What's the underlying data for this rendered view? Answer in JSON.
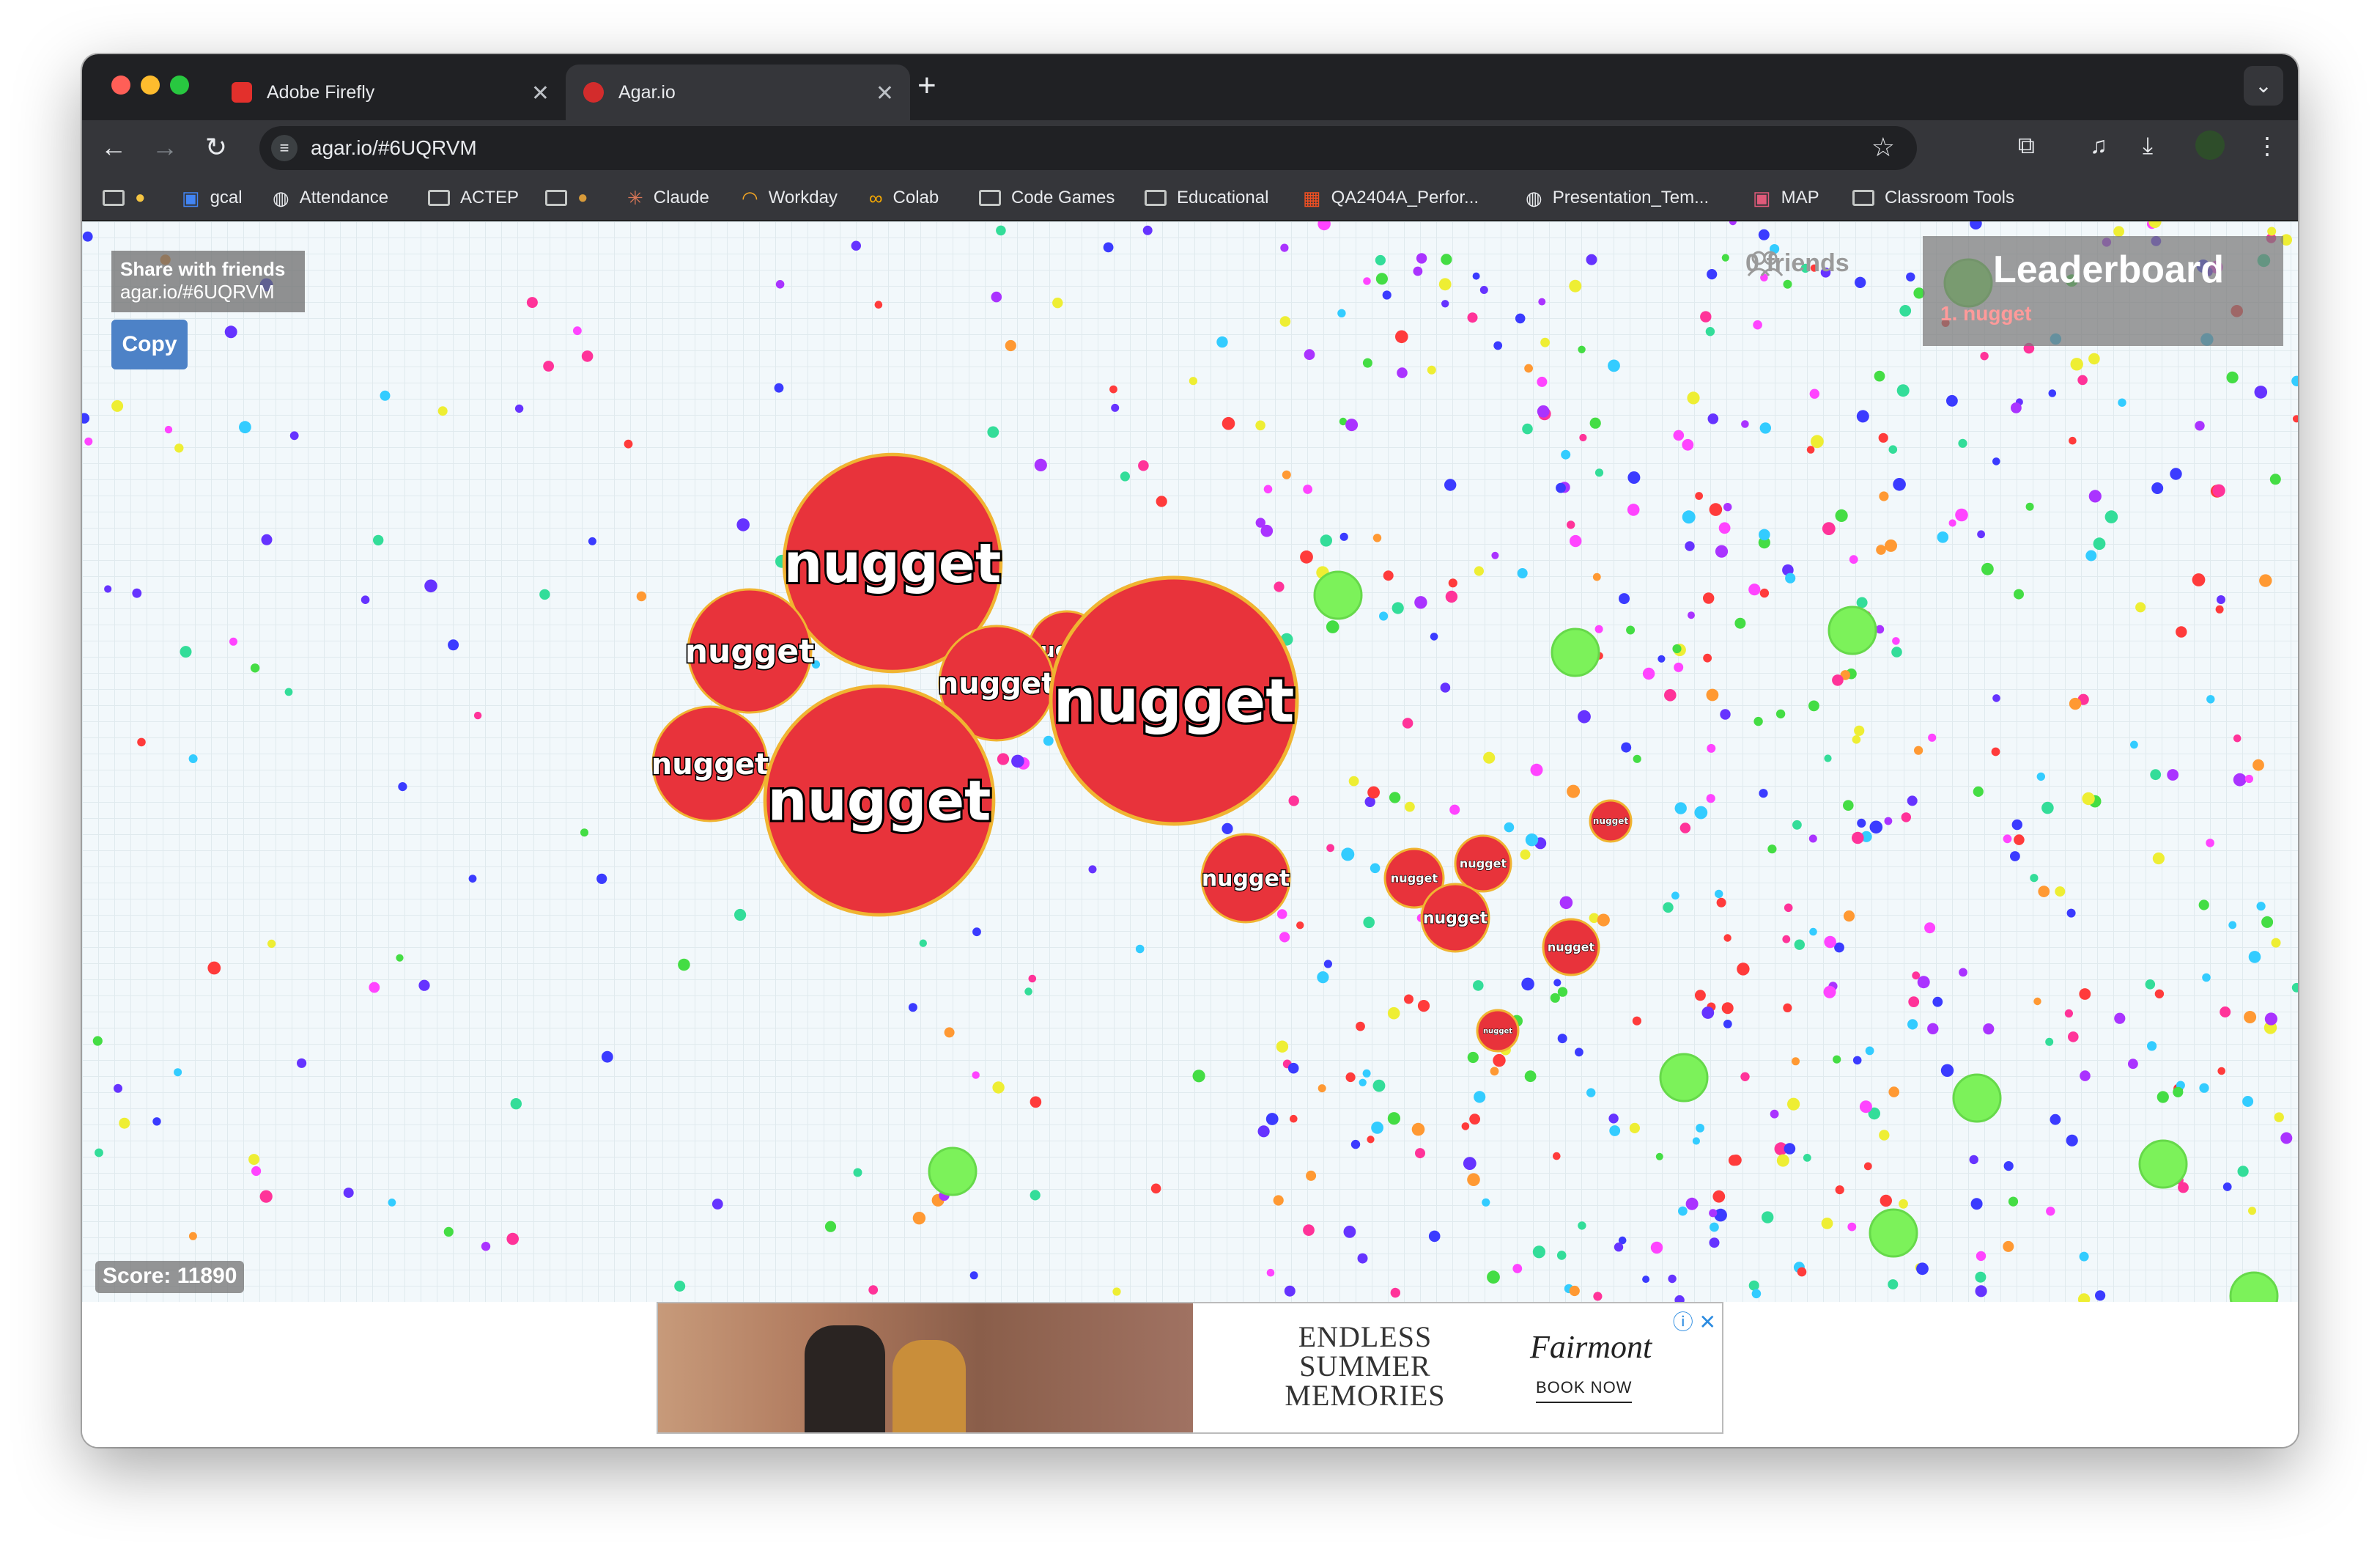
{
  "browser": {
    "tabs": [
      {
        "title": "Adobe Firefly",
        "favicon_color": "#e3302c"
      },
      {
        "title": "Agar.io",
        "favicon_color": "#d32c2c"
      }
    ],
    "new_tab_label": "+",
    "url": "agar.io/#6UQRVM",
    "bookmarks": [
      {
        "label": "",
        "icon": "folder-emoji-icon"
      },
      {
        "label": "gcal",
        "icon": "calendar-icon"
      },
      {
        "label": "Attendance",
        "icon": "globe-icon"
      },
      {
        "label": "ACTEP",
        "icon": "folder-icon"
      },
      {
        "label": "",
        "icon": "folder-emoji-icon"
      },
      {
        "label": "Claude",
        "icon": "claude-icon"
      },
      {
        "label": "Workday",
        "icon": "workday-icon"
      },
      {
        "label": "Colab",
        "icon": "colab-icon"
      },
      {
        "label": "Code Games",
        "icon": "folder-icon"
      },
      {
        "label": "Educational",
        "icon": "folder-icon"
      },
      {
        "label": "QA2404A_Perfor...",
        "icon": "microsoft-icon"
      },
      {
        "label": "Presentation_Tem...",
        "icon": "globe-icon"
      },
      {
        "label": "MAP",
        "icon": "map-icon"
      },
      {
        "label": "Classroom Tools",
        "icon": "folder-icon"
      }
    ]
  },
  "game": {
    "share": {
      "title": "Share with friends",
      "link": "agar.io/#6UQRVM"
    },
    "copy_label": "Copy",
    "friends_label": "0 friends",
    "leaderboard": {
      "title": "Leaderboard",
      "entries": [
        "1. nugget"
      ]
    },
    "score_label": "Score: 11890",
    "player_name": "nugget",
    "colors": {
      "cell": "#e8333b",
      "cell_border": "#f0b431",
      "virus": "#7cf25a"
    }
  },
  "ad": {
    "tagline": "ENDLESS SUMMER MEMORIES",
    "brand": "Fairmont",
    "cta": "BOOK NOW"
  }
}
